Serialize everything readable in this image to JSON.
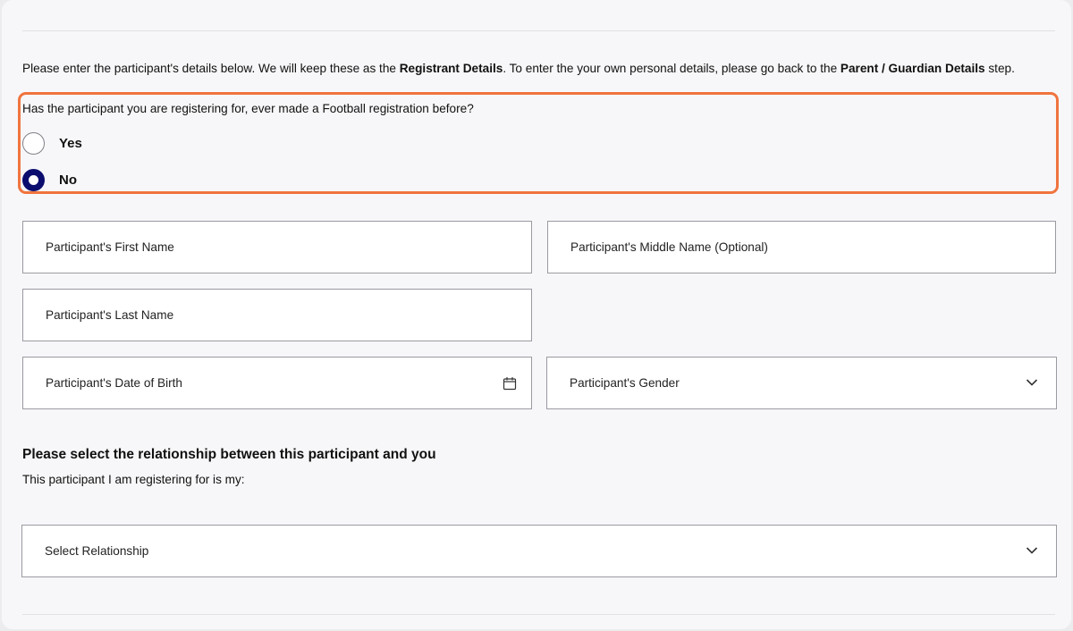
{
  "intro": {
    "text_1": "Please enter the participant's details below. We will keep these as the ",
    "bold_1": "Registrant Details",
    "text_2": ". To enter the your own personal details, please go back to the ",
    "bold_2": "Parent / Guardian Details",
    "text_3": " step."
  },
  "prior_registration": {
    "question": "Has the participant you are registering for, ever made a Football registration before?",
    "options": [
      {
        "label": "Yes",
        "selected": false
      },
      {
        "label": "No",
        "selected": true
      }
    ]
  },
  "fields": {
    "first_name": {
      "placeholder": "Participant's First Name",
      "value": ""
    },
    "middle_name": {
      "placeholder": "Participant's Middle Name (Optional)",
      "value": ""
    },
    "last_name": {
      "placeholder": "Participant's Last Name",
      "value": ""
    },
    "date_of_birth": {
      "placeholder": "Participant's Date of Birth",
      "value": "",
      "icon": "calendar-icon"
    },
    "gender": {
      "placeholder": "Participant's Gender",
      "value": "",
      "icon": "chevron-down-icon"
    }
  },
  "relationship": {
    "title": "Please select the relationship between this participant and you",
    "subtitle": "This participant I am registering for is my:",
    "select": {
      "placeholder": "Select Relationship",
      "value": "",
      "icon": "chevron-down-icon"
    }
  },
  "colors": {
    "highlight_border": "#f0743e",
    "radio_selected": "#0b0e6e"
  }
}
